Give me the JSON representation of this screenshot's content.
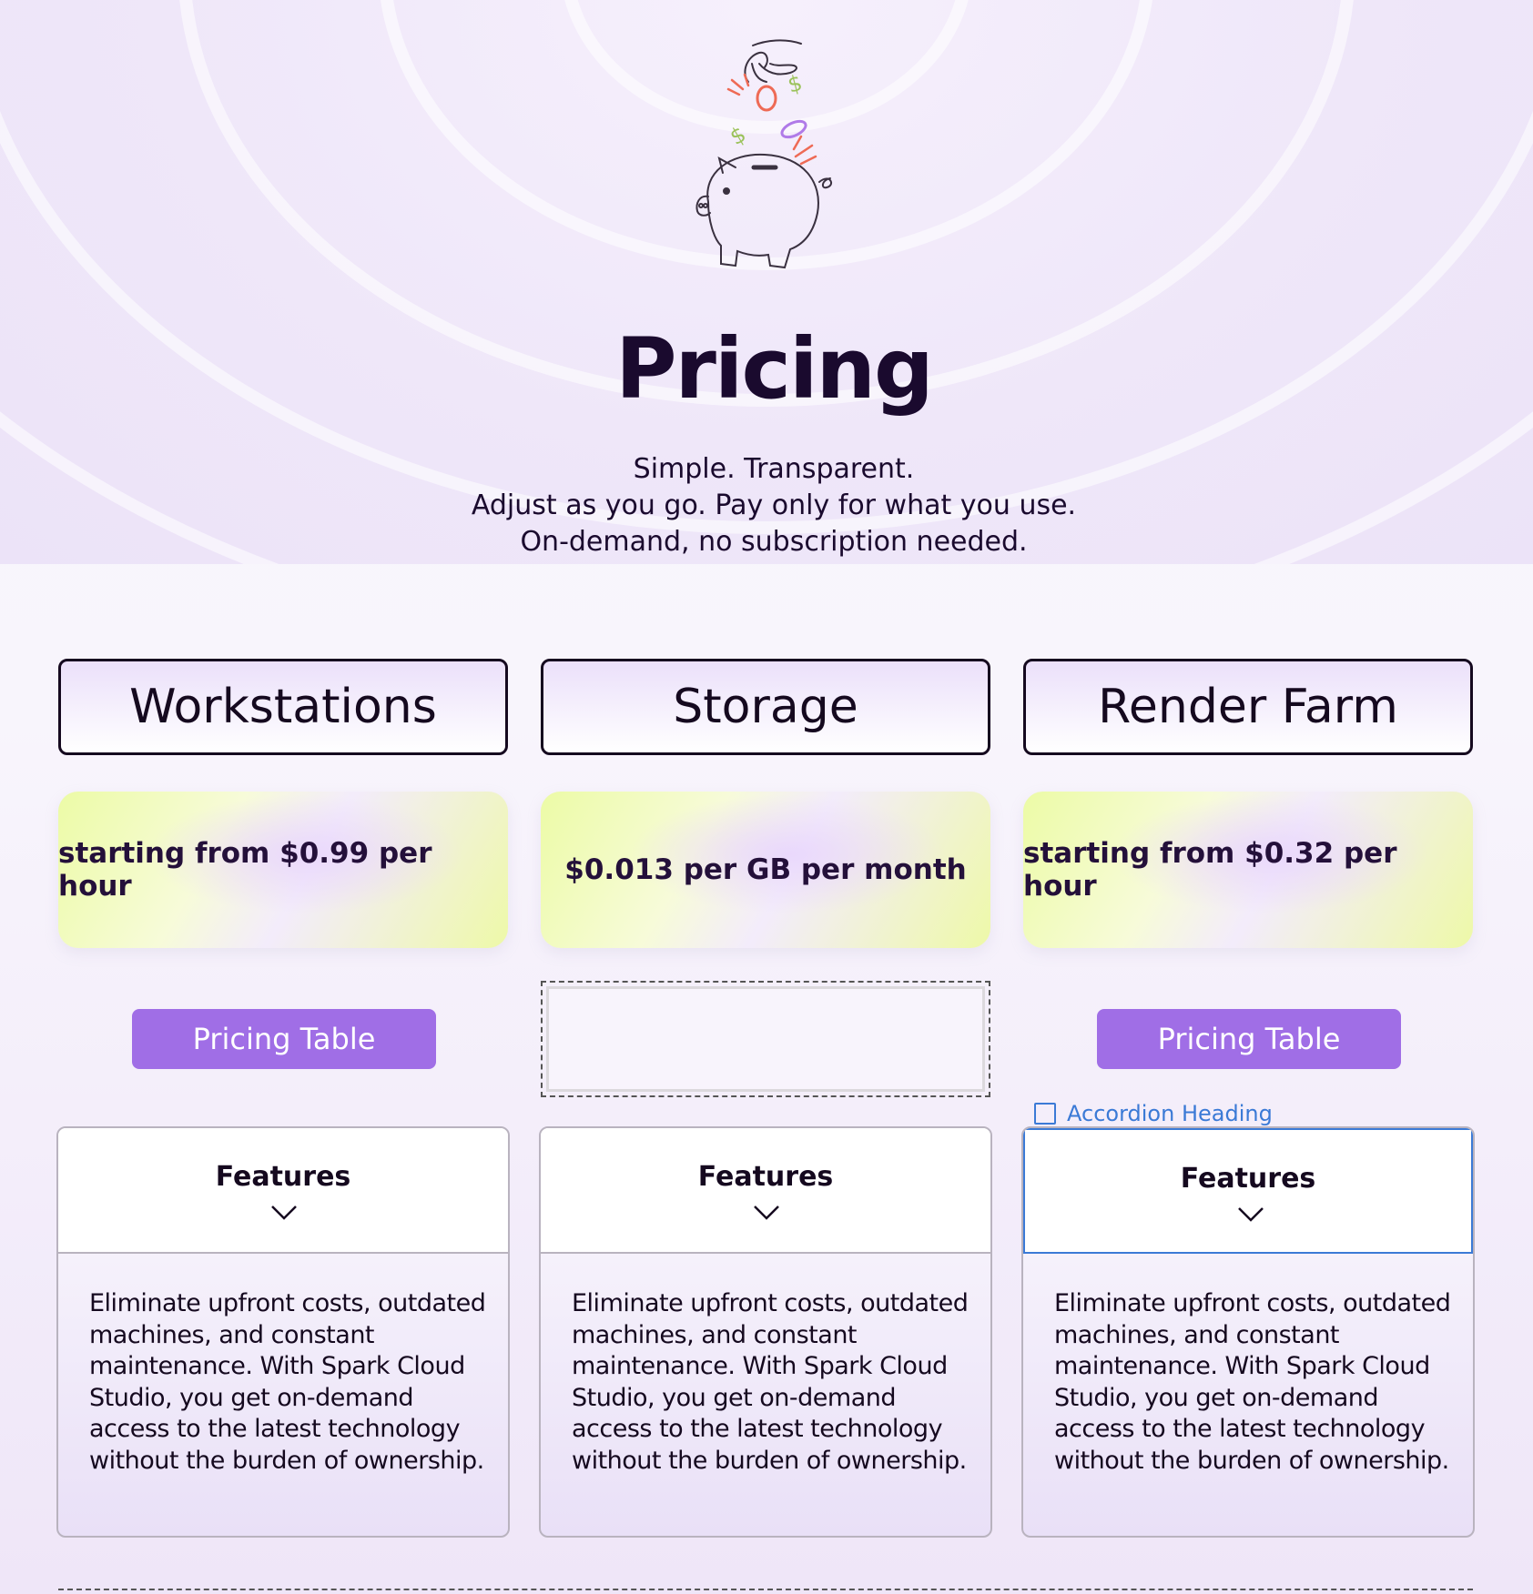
{
  "header": {
    "title": "Pricing",
    "subtitle_lines": [
      "Simple. Transparent.",
      "Adjust as you go. Pay only for what you use.",
      "On-demand, no subscription needed."
    ],
    "illustration_icon": "piggy-bank-with-coins-icon"
  },
  "plans": [
    {
      "name": "Workstations",
      "price": "starting from $0.99 per hour",
      "button_label": "Pricing Table",
      "accordion_title": "Features",
      "accordion_body": "Eliminate upfront costs, outdated machines, and constant maintenance. With Spark Cloud Studio, you get on-demand access to the latest technology without the burden of ownership."
    },
    {
      "name": "Storage",
      "price": "$0.013 per GB per month",
      "button_label": "",
      "accordion_title": "Features",
      "accordion_body": "Eliminate upfront costs, outdated machines, and constant maintenance. With Spark Cloud Studio, you get on-demand access to the latest technology without the burden of ownership."
    },
    {
      "name": "Render Farm",
      "price": "starting from $0.32 per hour",
      "button_label": "Pricing Table",
      "accordion_label": "Accordion Heading",
      "accordion_title": "Features",
      "accordion_body": "Eliminate upfront costs, outdated machines, and constant maintenance. With Spark Cloud Studio, you get on-demand access to the latest technology without the burden of ownership."
    }
  ],
  "colors": {
    "button_bg": "#a06ee6",
    "text_dark": "#15091f",
    "selection_blue": "#3b7ad6"
  }
}
